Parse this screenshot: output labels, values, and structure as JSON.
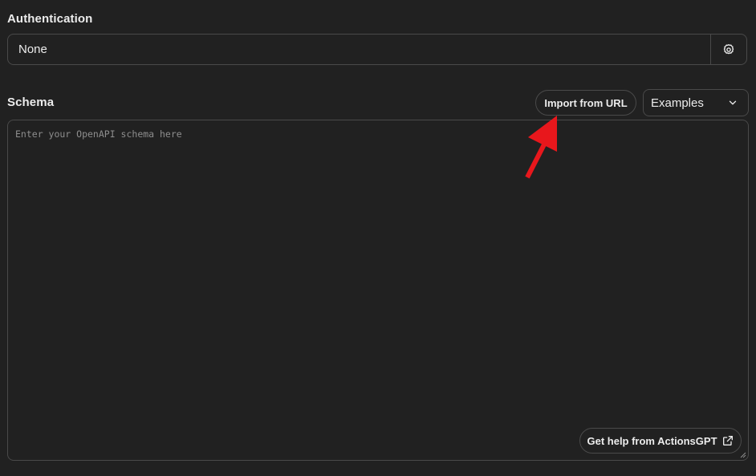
{
  "authentication": {
    "label": "Authentication",
    "value": "None",
    "settings_icon": "gear-icon"
  },
  "schema": {
    "label": "Schema",
    "import_button": "Import from URL",
    "examples_select": "Examples",
    "placeholder": "Enter your OpenAPI schema here",
    "help_button": "Get help from ActionsGPT",
    "help_icon": "external-link-icon"
  },
  "annotation": {
    "arrow_color": "#e8171c"
  },
  "colors": {
    "background": "#212121",
    "border": "#4a4a4a",
    "text": "#ececec",
    "placeholder": "#8e8e8e"
  }
}
